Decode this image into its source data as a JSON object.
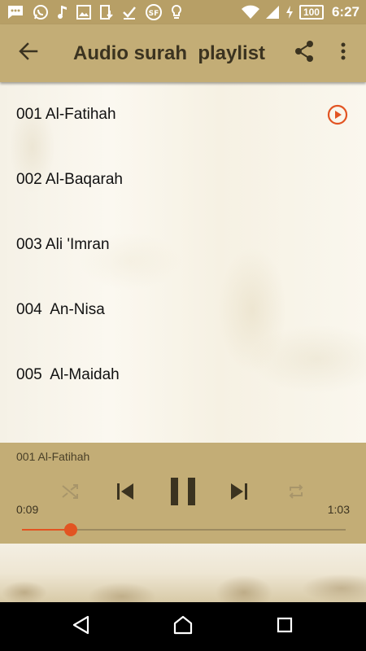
{
  "status_bar": {
    "time": "6:27",
    "battery": "100",
    "left_icons": [
      "message-icon",
      "whatsapp-icon",
      "music-note-icon",
      "image-icon",
      "download-icon",
      "check-icon",
      "sf-app-icon",
      "lightbulb-icon"
    ],
    "right_icons": [
      "wifi-icon",
      "cellular-signal-icon",
      "charging-icon"
    ]
  },
  "app_bar": {
    "title": "Audio surah  playlist",
    "back_icon": "arrow-back-icon",
    "share_icon": "share-icon",
    "more_icon": "more-vert-icon"
  },
  "playlist": {
    "items": [
      {
        "label": "001 Al-Fatihah",
        "playing": true
      },
      {
        "label": "002 Al-Baqarah",
        "playing": false
      },
      {
        "label": "003 Ali 'Imran",
        "playing": false
      },
      {
        "label": "004  An-Nisa",
        "playing": false
      },
      {
        "label": "005  Al-Maidah",
        "playing": false
      }
    ]
  },
  "player": {
    "now_playing": "001 Al-Fatihah",
    "current_time": "0:09",
    "total_time": "1:03",
    "progress": 0.15,
    "state": "playing",
    "controls": [
      "shuffle-icon",
      "skip-previous-icon",
      "pause-icon",
      "skip-next-icon",
      "repeat-icon"
    ]
  },
  "colors": {
    "accent": "#e25422",
    "bar": "#c3ad76",
    "status_bar": "#b79f66",
    "title_text": "#3b3320"
  },
  "nav_bar": {
    "buttons": [
      "back-triangle-icon",
      "home-icon",
      "recents-icon"
    ]
  }
}
